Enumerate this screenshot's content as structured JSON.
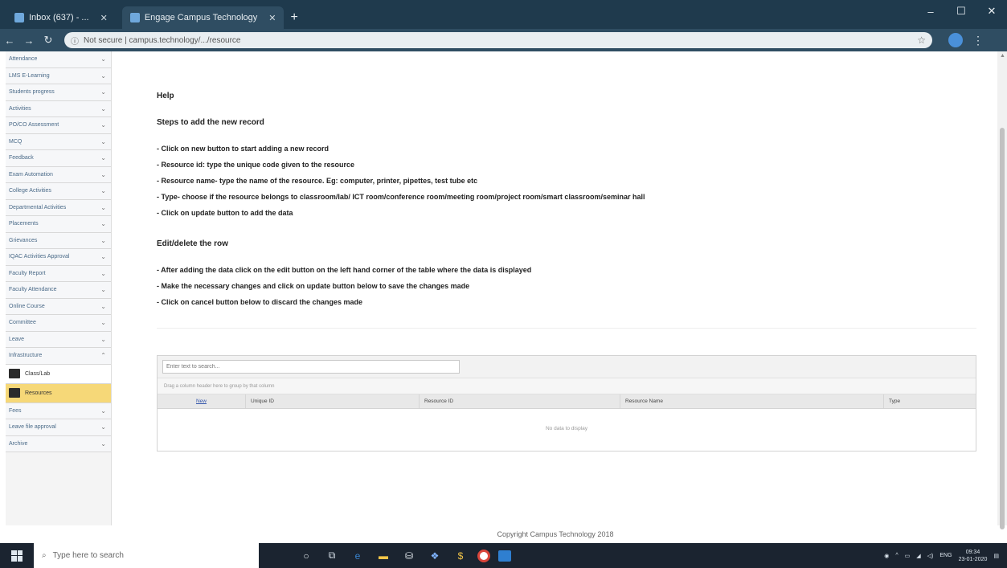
{
  "browser": {
    "tabs": [
      {
        "label": "Inbox (637) - ..."
      },
      {
        "label": "Engage Campus Technology"
      }
    ],
    "url": "Not secure | campus.technology/.../resource",
    "new_tab_glyph": "+",
    "window_controls": [
      "–",
      "☐",
      "✕"
    ]
  },
  "sidebar": {
    "items": [
      {
        "label": "Attendance"
      },
      {
        "label": "LMS E-Learning"
      },
      {
        "label": "Students progress"
      },
      {
        "label": "Activities"
      },
      {
        "label": "PO/CO Assessment"
      },
      {
        "label": "MCQ"
      },
      {
        "label": "Feedback"
      },
      {
        "label": "Exam Automation"
      },
      {
        "label": "College Activities"
      },
      {
        "label": "Departmental Activities"
      },
      {
        "label": "Placements"
      },
      {
        "label": "Grievances"
      },
      {
        "label": "IQAC Activities Approval"
      },
      {
        "label": "Faculty Report"
      },
      {
        "label": "Faculty Attendance"
      },
      {
        "label": "Online Course"
      },
      {
        "label": "Committee"
      },
      {
        "label": "Leave"
      },
      {
        "label": "Infrastructure"
      }
    ],
    "sub_items": [
      {
        "label": "Class/Lab"
      },
      {
        "label": "Resources"
      }
    ],
    "items_after": [
      {
        "label": "Fees"
      },
      {
        "label": "Leave file approval"
      },
      {
        "label": "Archive"
      }
    ]
  },
  "help": {
    "title": "Help",
    "steps_heading": "Steps to add the new record",
    "steps": [
      "- Click on new button to start adding a new record",
      "- Resource id: type the unique code given to the resource",
      "- Resource name- type the name of the resource. Eg: computer, printer, pipettes, test tube etc",
      "- Type- choose if the resource belongs to classroom/lab/ ICT room/conference room/meeting room/project room/smart classroom/seminar hall",
      "- Click on update button to add the data"
    ],
    "edit_heading": "Edit/delete the row",
    "edit_steps": [
      "- After adding the data click on the edit button on the left hand corner of the table where the data is displayed",
      "- Make the necessary changes and click on update button below to save the changes made",
      "- Click on cancel button below to discard the changes made"
    ]
  },
  "grid": {
    "search_placeholder": "Enter text to search...",
    "group_panel_text": "Drag a column header here to group by that column",
    "columns": {
      "new": "New",
      "unique_id": "Unique ID",
      "resource_id": "Resource ID",
      "resource_name": "Resource Name",
      "type": "Type"
    },
    "empty_text": "No data to display"
  },
  "footer": {
    "text": "Copyright Campus Technology 2018"
  },
  "taskbar": {
    "search_placeholder": "Type here to search",
    "clock_time": "09:34",
    "clock_date": "23-01-2020",
    "language": "ENG"
  },
  "colors": {
    "tabbar": "#1f3a4d",
    "active_sidebar": "#f6d878",
    "taskbar": "#1b2430"
  }
}
